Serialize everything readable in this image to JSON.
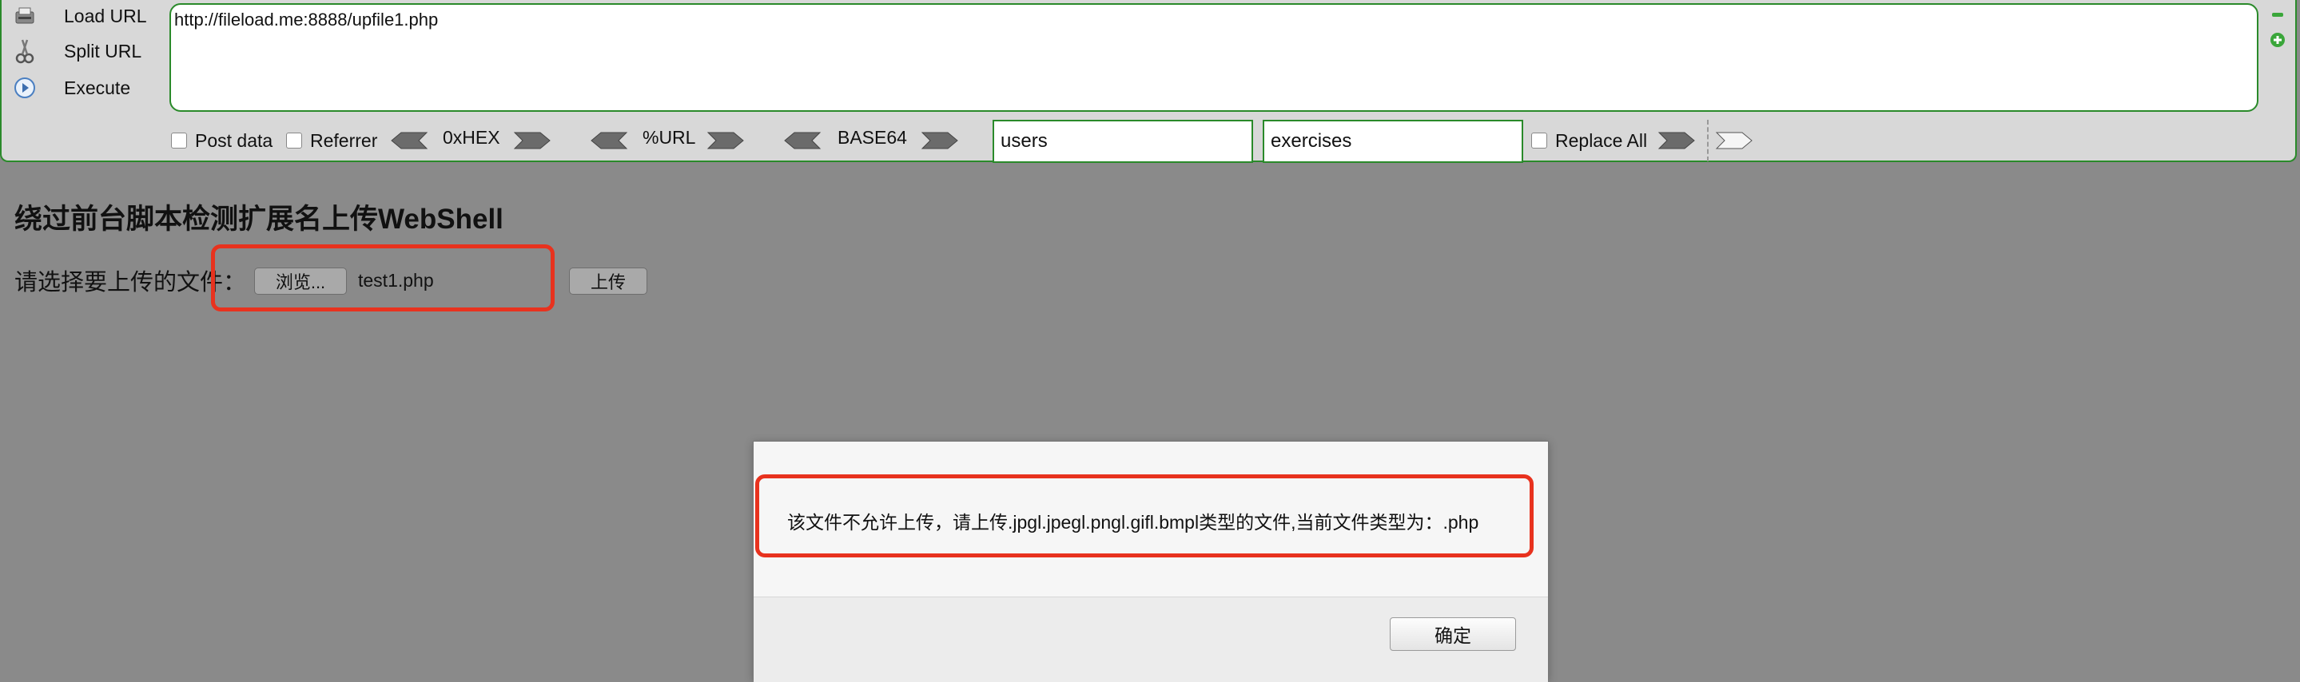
{
  "hackbar": {
    "buttons": [
      {
        "label": "Load URL",
        "icon": "load-url-icon"
      },
      {
        "label": "Split URL",
        "icon": "split-url-icon"
      },
      {
        "label": "Execute",
        "icon": "execute-icon"
      }
    ],
    "url": "http://fileload.me:8888/upfile1.php",
    "post_data_label": "Post data",
    "referrer_label": "Referrer",
    "hex_label": "0xHEX",
    "url_enc_label": "%URL",
    "base64_label": "BASE64",
    "search_value": "users",
    "replace_value": "exercises",
    "replace_all_label": "Replace All",
    "accent_color": "#2a8a2a"
  },
  "page": {
    "title": "绕过前台脚本检测扩展名上传WebShell",
    "file_label": "请选择要上传的文件：",
    "browse_label": "浏览...",
    "file_name": "test1.php",
    "upload_label": "上传",
    "highlight_color": "#e8321e"
  },
  "dialog": {
    "message": "该文件不允许上传，请上传.jpgl.jpegl.pngl.gifl.bmpl类型的文件,当前文件类型为：.php",
    "ok_label": "确定"
  }
}
